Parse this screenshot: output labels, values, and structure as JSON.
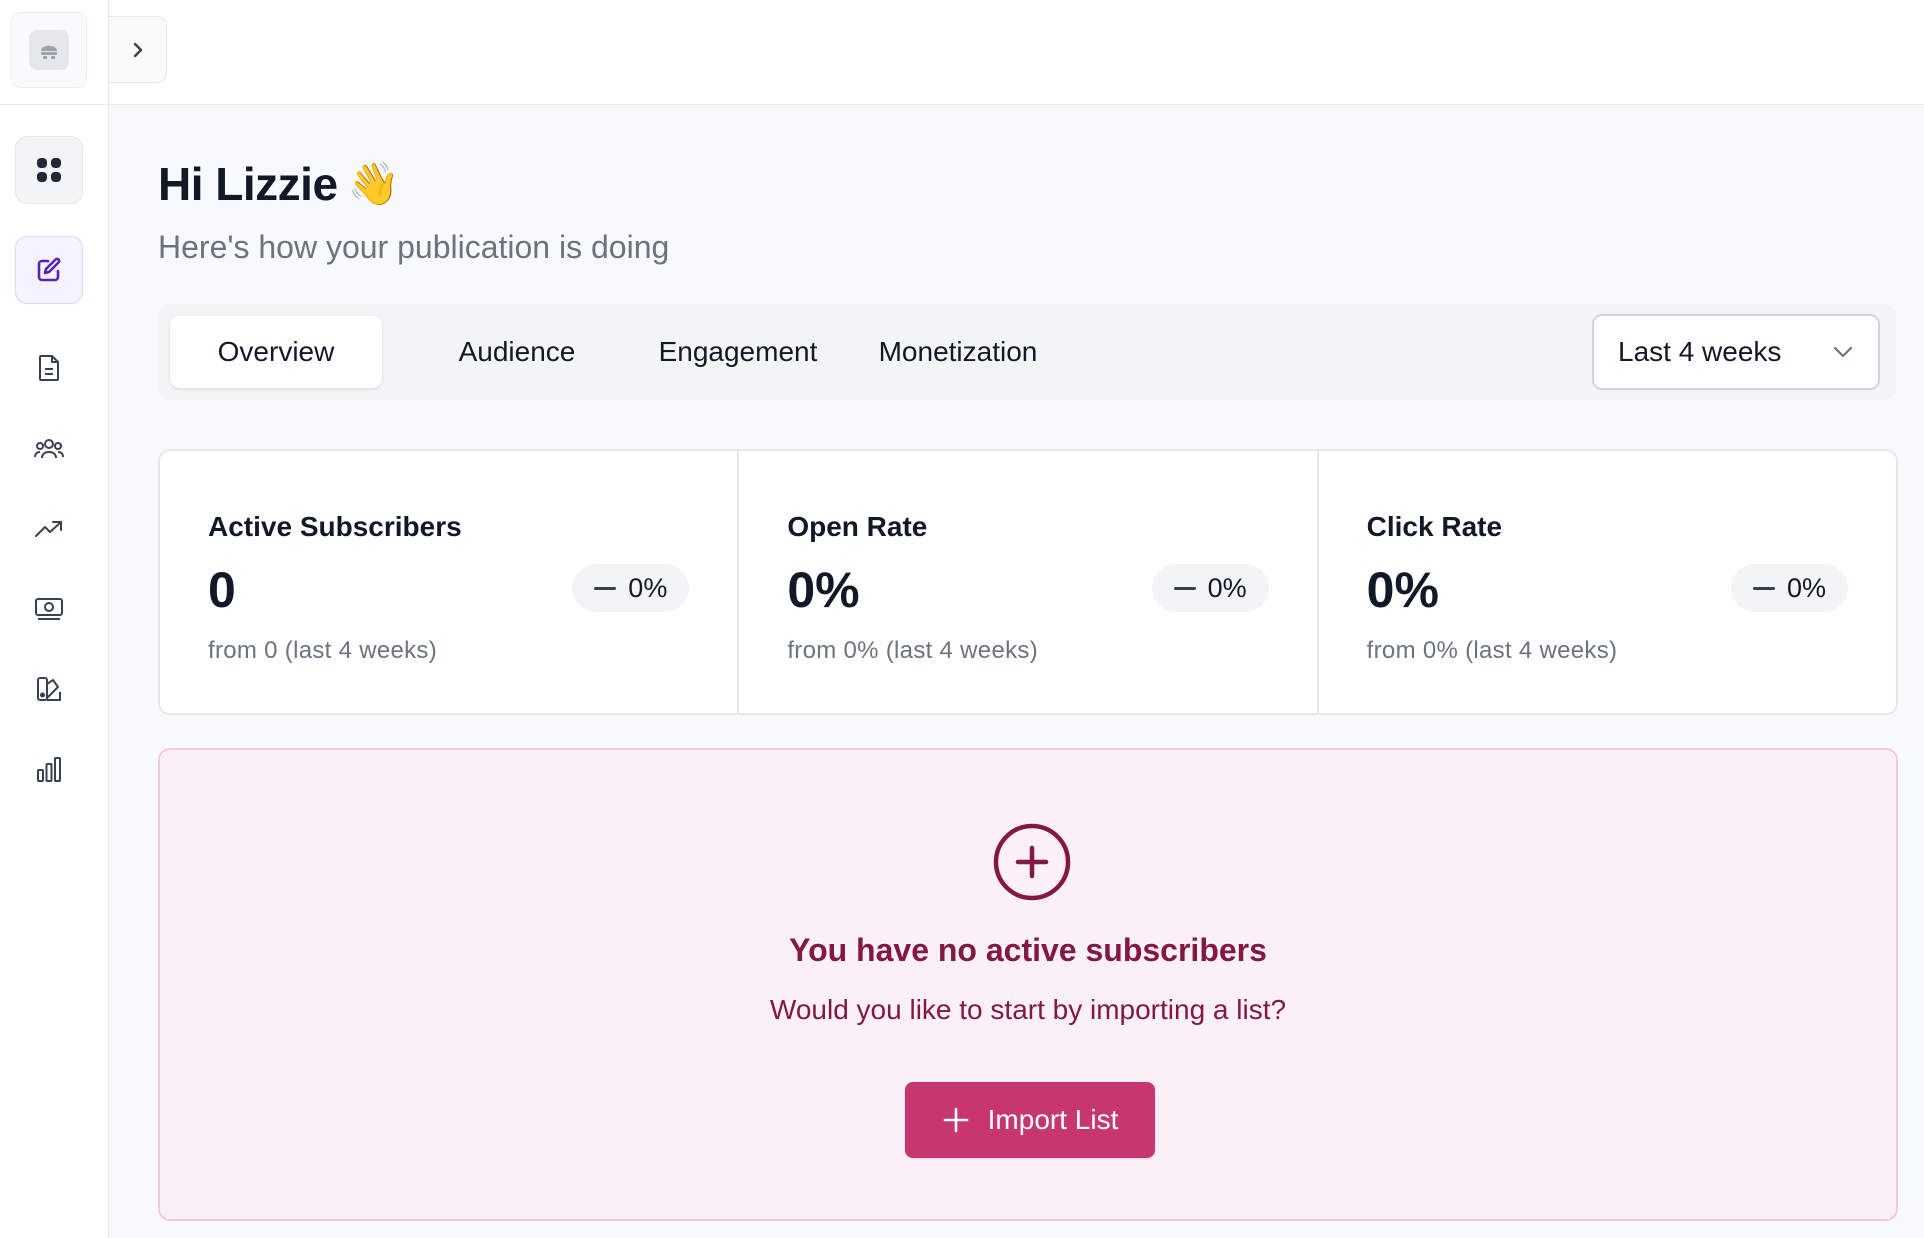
{
  "sidebar": {
    "items": [
      {
        "name": "dashboard",
        "icon": "grid-icon"
      },
      {
        "name": "compose",
        "icon": "edit-icon"
      },
      {
        "name": "posts",
        "icon": "document-icon"
      },
      {
        "name": "audience",
        "icon": "users-icon"
      },
      {
        "name": "growth",
        "icon": "trending-up-icon"
      },
      {
        "name": "monetization",
        "icon": "money-icon"
      },
      {
        "name": "design",
        "icon": "design-icon"
      },
      {
        "name": "analytics",
        "icon": "bar-chart-icon"
      }
    ]
  },
  "header": {
    "greeting": "Hi Lizzie",
    "emoji": "👋",
    "subtitle": "Here's how your publication is doing"
  },
  "tabs": [
    {
      "label": "Overview",
      "active": true
    },
    {
      "label": "Audience",
      "active": false
    },
    {
      "label": "Engagement",
      "active": false
    },
    {
      "label": "Monetization",
      "active": false
    }
  ],
  "range": {
    "selected": "Last 4 weeks"
  },
  "stats": [
    {
      "title": "Active Subscribers",
      "value": "0",
      "change": "0%",
      "from": "from 0 (last 4 weeks)"
    },
    {
      "title": "Open Rate",
      "value": "0%",
      "change": "0%",
      "from": "from 0% (last 4 weeks)"
    },
    {
      "title": "Click Rate",
      "value": "0%",
      "change": "0%",
      "from": "from 0% (last 4 weeks)"
    }
  ],
  "empty_state": {
    "title": "You have no active subscribers",
    "subtitle": "Would you like to start by importing a list?",
    "button_label": "Import List"
  },
  "colors": {
    "accent": "#c73670",
    "empty_text": "#831843",
    "empty_bg": "#fbf0f5",
    "compose_icon": "#5b21b6"
  }
}
